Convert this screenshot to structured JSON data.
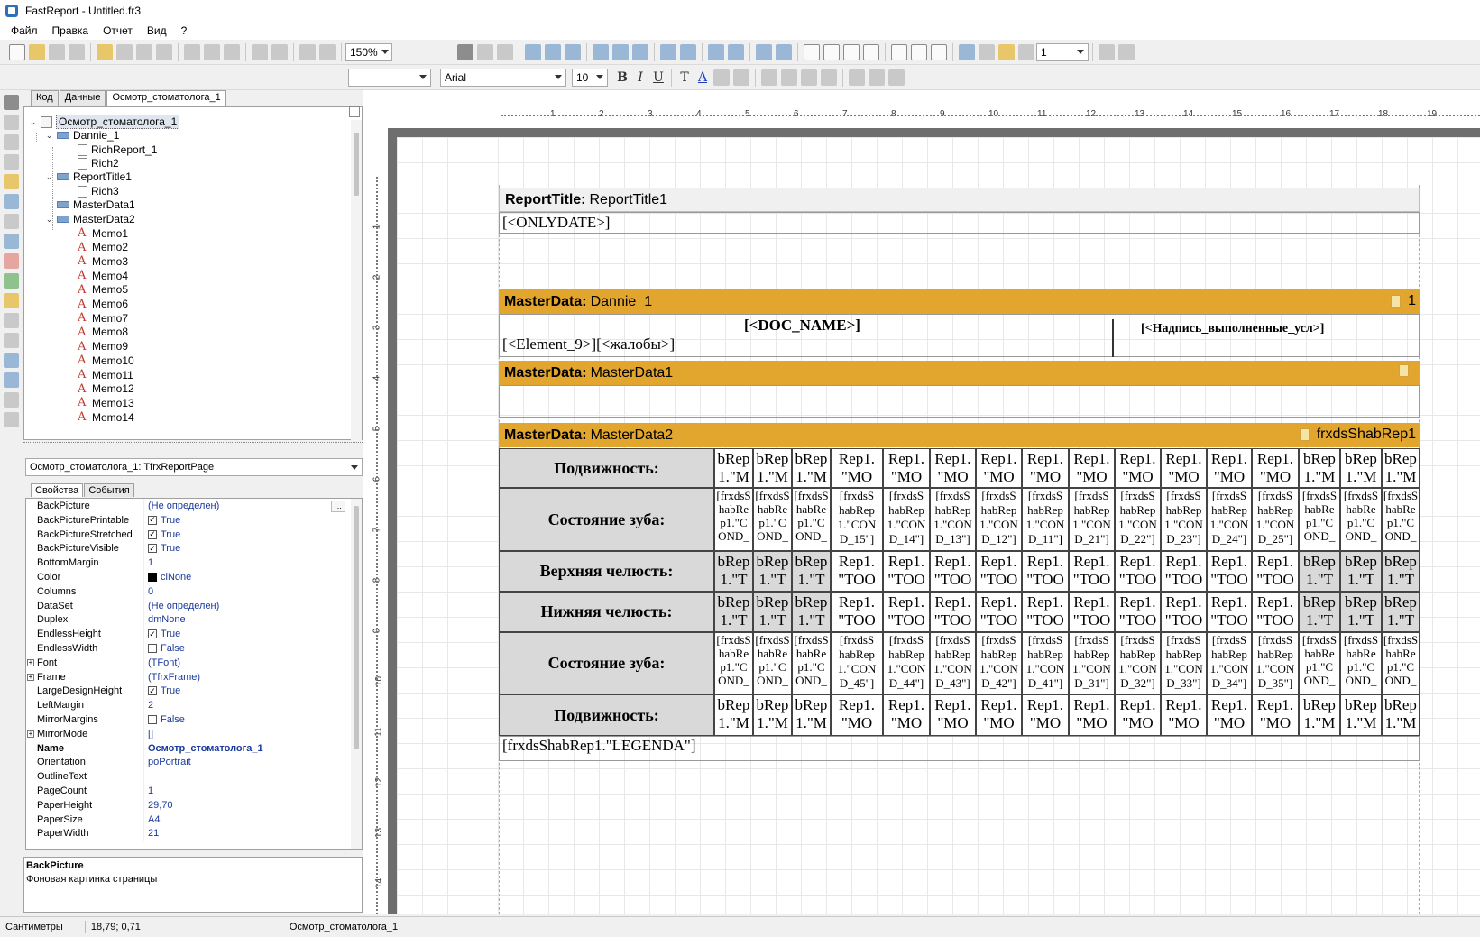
{
  "window_title": "FastReport - Untitled.fr3",
  "menu": [
    "Файл",
    "Правка",
    "Отчет",
    "Вид",
    "?"
  ],
  "zoom": "150%",
  "font_name": "Arial",
  "font_size": "10",
  "line_width": "1",
  "tabs": [
    "Код",
    "Данные",
    "Осмотр_стоматолога_1"
  ],
  "tree": {
    "root": "Осмотр_стоматолога_1",
    "items": [
      "Dannie_1",
      "RichReport_1",
      "Rich2",
      "ReportTitle1",
      "Rich3",
      "MasterData1",
      "MasterData2",
      "Memo1",
      "Memo2",
      "Memo3",
      "Memo4",
      "Memo5",
      "Memo6",
      "Memo7",
      "Memo8",
      "Memo9",
      "Memo10",
      "Memo11",
      "Memo12",
      "Memo13",
      "Memo14"
    ]
  },
  "object_combo": "Осмотр_стоматолога_1: TfrxReportPage",
  "prop_tabs": [
    "Свойства",
    "События"
  ],
  "properties": [
    {
      "name": "BackPicture",
      "value": "(Не определен)"
    },
    {
      "name": "BackPicturePrintable",
      "value": "True",
      "check": true
    },
    {
      "name": "BackPictureStretched",
      "value": "True",
      "check": true
    },
    {
      "name": "BackPictureVisible",
      "value": "True",
      "check": true
    },
    {
      "name": "BottomMargin",
      "value": "1"
    },
    {
      "name": "Color",
      "value": "clNone",
      "swatch": "#000000"
    },
    {
      "name": "Columns",
      "value": "0"
    },
    {
      "name": "DataSet",
      "value": "(Не определен)"
    },
    {
      "name": "Duplex",
      "value": "dmNone"
    },
    {
      "name": "EndlessHeight",
      "value": "True",
      "check": true
    },
    {
      "name": "EndlessWidth",
      "value": "False",
      "check": false
    },
    {
      "name": "Font",
      "value": "(TFont)",
      "expand": true
    },
    {
      "name": "Frame",
      "value": "(TfrxFrame)",
      "expand": true
    },
    {
      "name": "LargeDesignHeight",
      "value": "True",
      "check": true
    },
    {
      "name": "LeftMargin",
      "value": "2"
    },
    {
      "name": "MirrorMargins",
      "value": "False",
      "check": false
    },
    {
      "name": "MirrorMode",
      "value": "[]",
      "expand": true
    },
    {
      "name": "Name",
      "value": "Осмотр_стоматолога_1",
      "bold": true
    },
    {
      "name": "Orientation",
      "value": "poPortrait"
    },
    {
      "name": "OutlineText",
      "value": ""
    },
    {
      "name": "PageCount",
      "value": "1"
    },
    {
      "name": "PaperHeight",
      "value": "29,70"
    },
    {
      "name": "PaperSize",
      "value": "A4"
    },
    {
      "name": "PaperWidth",
      "value": "21"
    }
  ],
  "hint": {
    "title": "BackPicture",
    "text": "Фоновая картинка страницы"
  },
  "status": {
    "units": "Сантиметры",
    "coords": "18,79; 0,71",
    "page": "Осмотр_стоматолога_1"
  },
  "ruler": {
    "h": [
      "1",
      "2",
      "3",
      "4",
      "5",
      "6",
      "7",
      "8",
      "9",
      "10",
      "11",
      "12",
      "13",
      "14",
      "15",
      "16",
      "17",
      "18",
      "19"
    ],
    "v": [
      "1",
      "2",
      "3",
      "4",
      "5",
      "6",
      "7",
      "8",
      "9",
      "10",
      "11",
      "12",
      "13",
      "14"
    ]
  },
  "bands": {
    "report_title": {
      "type": "ReportTitle:",
      "name": "ReportTitle1",
      "field": "[<ONLYDATE>]"
    },
    "master1": {
      "type": "MasterData:",
      "name": "Dannie_1",
      "right": "1",
      "doc_name": "[<DOC_NAME>]",
      "element": "[<Element_9>][<жалобы>]",
      "inscription": "[<Надпись_выполненные_усл>]"
    },
    "master2": {
      "type": "MasterData:",
      "name": "MasterData1"
    },
    "master3": {
      "type": "MasterData:",
      "name": "MasterData2",
      "right": "frxdsShabRep1"
    },
    "legend": "[frxdsShabRep1.\"LEGENDA\"]"
  },
  "table": {
    "row_labels": [
      "Подвижность:",
      "Состояние зуба:",
      "Верхняя челюсть:",
      "Нижняя челюсть:",
      "Состояние зуба:",
      "Подвижность:"
    ],
    "row_mob": [
      "bRep\n1.\"M",
      "bRep\n1.\"M",
      "bRep\n1.\"M",
      "Rep1.\n\"MO",
      "Rep1.\n\"MO",
      "Rep1.\n\"MO",
      "Rep1.\n\"MO",
      "Rep1.\n\"MO",
      "Rep1.\n\"MO",
      "Rep1.\n\"MO",
      "Rep1.\n\"MO",
      "Rep1.\n\"MO",
      "Rep1.\n\"MO",
      "bRep\n1.\"M",
      "bRep\n1.\"M",
      "bRep\n1.\"M"
    ],
    "row_state_top": [
      "[frxdsS\nhabRe\np1.\"C\nOND_",
      "[frxdsS\nhabRe\np1.\"C\nOND_",
      "[frxdsS\nhabRe\np1.\"C\nOND_",
      "[frxdsS\nhabRep\n1.\"CON\nD_15\"]",
      "[frxdsS\nhabRep\n1.\"CON\nD_14\"]",
      "[frxdsS\nhabRep\n1.\"CON\nD_13\"]",
      "[frxdsS\nhabRep\n1.\"CON\nD_12\"]",
      "[frxdsS\nhabRep\n1.\"CON\nD_11\"]",
      "[frxdsS\nhabRep\n1.\"CON\nD_21\"]",
      "[frxdsS\nhabRep\n1.\"CON\nD_22\"]",
      "[frxdsS\nhabRep\n1.\"CON\nD_23\"]",
      "[frxdsS\nhabRep\n1.\"CON\nD_24\"]",
      "[frxdsS\nhabRep\n1.\"CON\nD_25\"]",
      "[frxdsS\nhabRe\np1.\"C\nOND_",
      "[frxdsS\nhabRe\np1.\"C\nOND_",
      "[frxdsS\nhabRe\np1.\"C\nOND_"
    ],
    "row_jaw": [
      "bRep\n1.\"T\nOOT",
      "bRep\n1.\"T\nOOT",
      "bRep\n1.\"T\nOOT",
      "Rep1.\n\"TOO",
      "Rep1.\n\"TOO",
      "Rep1.\n\"TOO",
      "Rep1.\n\"TOO",
      "Rep1.\n\"TOO",
      "Rep1.\n\"TOO",
      "Rep1.\n\"TOO",
      "Rep1.\n\"TOO",
      "Rep1.\n\"TOO",
      "Rep1.\n\"TOO",
      "bRep\n1.\"T\nOOT",
      "bRep\n1.\"T\nOOT",
      "bRep\n1.\"T\nOOT"
    ],
    "row_state_bot": [
      "[frxdsS\nhabRe\np1.\"C\nOND_",
      "[frxdsS\nhabRe\np1.\"C\nOND_",
      "[frxdsS\nhabRe\np1.\"C\nOND_",
      "[frxdsS\nhabRep\n1.\"CON\nD_45\"]",
      "[frxdsS\nhabRep\n1.\"CON\nD_44\"]",
      "[frxdsS\nhabRep\n1.\"CON\nD_43\"]",
      "[frxdsS\nhabRep\n1.\"CON\nD_42\"]",
      "[frxdsS\nhabRep\n1.\"CON\nD_41\"]",
      "[frxdsS\nhabRep\n1.\"CON\nD_31\"]",
      "[frxdsS\nhabRep\n1.\"CON\nD_32\"]",
      "[frxdsS\nhabRep\n1.\"CON\nD_33\"]",
      "[frxdsS\nhabRep\n1.\"CON\nD_34\"]",
      "[frxdsS\nhabRep\n1.\"CON\nD_35\"]",
      "[frxdsS\nhabRe\np1.\"C\nOND_",
      "[frxdsS\nhabRe\np1.\"C\nOND_",
      "[frxdsS\nhabRe\np1.\"C\nOND_"
    ]
  }
}
